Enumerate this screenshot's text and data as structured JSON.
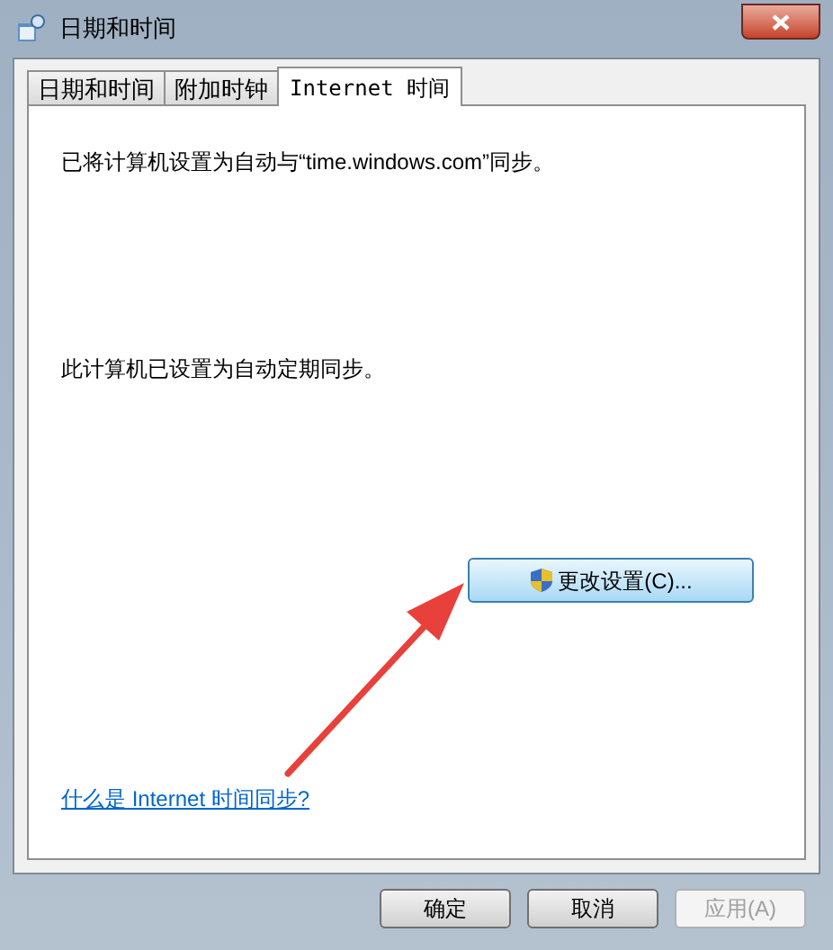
{
  "window": {
    "title": "日期和时间"
  },
  "tabs": [
    {
      "label": "日期和时间",
      "selected": false
    },
    {
      "label": "附加时钟",
      "selected": false
    },
    {
      "label": "Internet 时间",
      "selected": true
    }
  ],
  "messages": [
    "已将计算机设置为自动与“time.windows.com”同步。",
    "此计算机已设置为自动定期同步。"
  ],
  "change_button": {
    "label": "更改设置(C)..."
  },
  "help_link": "什么是 Internet 时间同步?",
  "buttons": [
    {
      "label": "确定",
      "disabled": false
    },
    {
      "label": "取消",
      "disabled": false
    },
    {
      "label": "应用(A)",
      "disabled": true
    }
  ]
}
